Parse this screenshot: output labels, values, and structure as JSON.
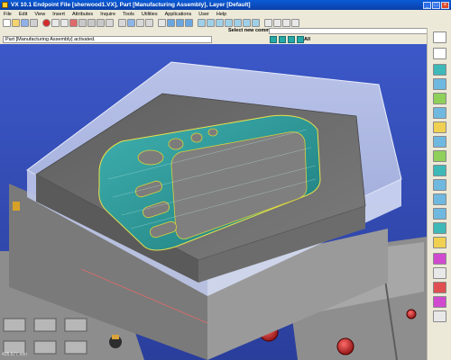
{
  "window": {
    "title": "VX 10.1 Endpoint     File [sherwood1.VX], Part [Manufacturing Assembly], Layer [Default]",
    "minimize": "_",
    "maximize": "□",
    "close": "×"
  },
  "menu": [
    "File",
    "Edit",
    "View",
    "Insert",
    "Attributes",
    "Inquire",
    "Tools",
    "Utilities",
    "Applications",
    "User",
    "Help"
  ],
  "prompt": {
    "label": "Select new command."
  },
  "status": {
    "message": "Part [Manufacturing Assembly] activated.",
    "filter_label": "All"
  },
  "readout": {
    "text": "405.677 mm"
  },
  "colors": {
    "viewport_top": "#3b55c6",
    "viewport_bottom": "#2a3f9e",
    "mold_gray": "#6e6e6e",
    "part_teal": "#2f9a9a",
    "glass": "#c9d3f2"
  }
}
